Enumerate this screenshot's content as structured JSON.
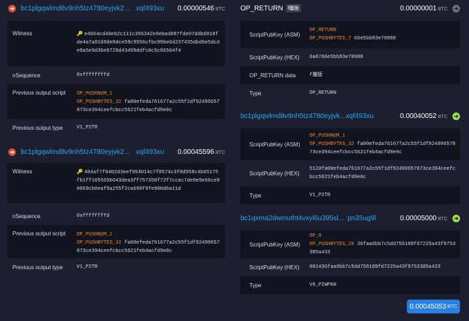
{
  "unit": "BTC",
  "inputs": [
    {
      "address_start": "bc1plgqwlmd8v9nh5tz4780eyjvk2...",
      "address_end": "xqf493xu",
      "amount": "0.00000546",
      "witness": "e4664cd40eb2c111c356342e9ebad887fde07ddb6818fde4a7a8168de8dce59c9556cfbc99be6d237435dbd6e5dcde9a5e9d36e0728d43499ddfc0c5c86564f4",
      "nsequence": "0xffffffffd",
      "prev_script_op1": "OP_PUSHNUM_1",
      "prev_script_op2": "OP_PUSHBYTES_32",
      "prev_script_data": "fa00efeda761677a2c55f1df92499657873ce394ceefcbcc5621feb4acfd9e0c",
      "prev_type": "V1_P2TR"
    },
    {
      "address_start": "bc1plgqwlmd8v9nh5tz4780eyjvk2...",
      "address_end": "xqf493xu",
      "amount": "0.00045596",
      "witness": "404af7f8402d3eef954014c7f8574c3f8d558c4b65175fb1ff105565b643dea3ff757358f72f7ccac7de6e9e66ce90069cb0eaf9a255f2ca690f9fe900d6a11d",
      "nsequence": "0xffffffffd",
      "prev_script_op1": "OP_PUSHNUM_1",
      "prev_script_op2": "OP_PUSHBYTES_32",
      "prev_script_data": "fa00efeda761677a2c55f1df92499657873ce394ceefcbcc5621feb4acfd9e0c",
      "prev_type": "V1_P2TR"
    }
  ],
  "labels": {
    "witness": "Witness",
    "nsequence": "nSequence",
    "prev_script": "Previous output script",
    "prev_type": "Previous output type",
    "asm": "ScriptPubKey (ASM)",
    "hex": "ScriptPubKey (HEX)",
    "op_return_data": "OP_RETURN data",
    "type": "Type"
  },
  "outputs": {
    "op_return": {
      "title": "OP_RETURN",
      "badge": "f魔版",
      "amount": "0.00000001",
      "asm_op1": "OP_RETURN",
      "asm_op2": "OP_PUSHBYTES_7",
      "asm_data": "66e5bb83e78988",
      "hex": "6a0766e5bb83e78988",
      "data": "f魔版",
      "type": "OP_RETURN"
    },
    "taproot": {
      "address_start": "bc1plgqwlmd8v9nh5tz4780eyjvk...",
      "address_end": "xqf493xu",
      "amount": "0.00040052",
      "asm_op1": "OP_PUSHNUM_1",
      "asm_op2": "OP_PUSHBYTES_32",
      "asm_data": "fa00efeda761677a2c55f1df92499657873ce394ceefcbcc5621feb4acfd9e0c",
      "hex": "5120fa00efeda761677a2c55f1df92499657873ce394ceefcbcc5621feb4acfd9e0c",
      "type": "V1_P2TR"
    },
    "wpkh": {
      "address_start": "bc1qxma2dwmutht4vxyl6u395sl...",
      "address_end": "pn35ug9l",
      "amount": "0.00005000",
      "asm_op1": "OP_0",
      "asm_op2": "OP_PUSHBYTES_20",
      "asm_data": "36faa6bb7c5dd756189fd7225a43f9753385a433",
      "hex": "001436faa6bb7c5dd756189fd7225a43f9753385a433",
      "type": "V0_P2WPKH"
    }
  },
  "total": "0.00045053",
  "icons": {
    "input": "arrow-right-circle-icon",
    "output_spent": "arrow-right-circle-icon",
    "witness_key": "key-icon"
  },
  "colors": {
    "background": "#1d1f31",
    "row_dark": "#11131f",
    "address": "#1ea8f0",
    "opcode": "#f28a24",
    "input_icon": "#e0502c",
    "output_icon": "#9be14b",
    "total_button": "#2a7ee0"
  }
}
